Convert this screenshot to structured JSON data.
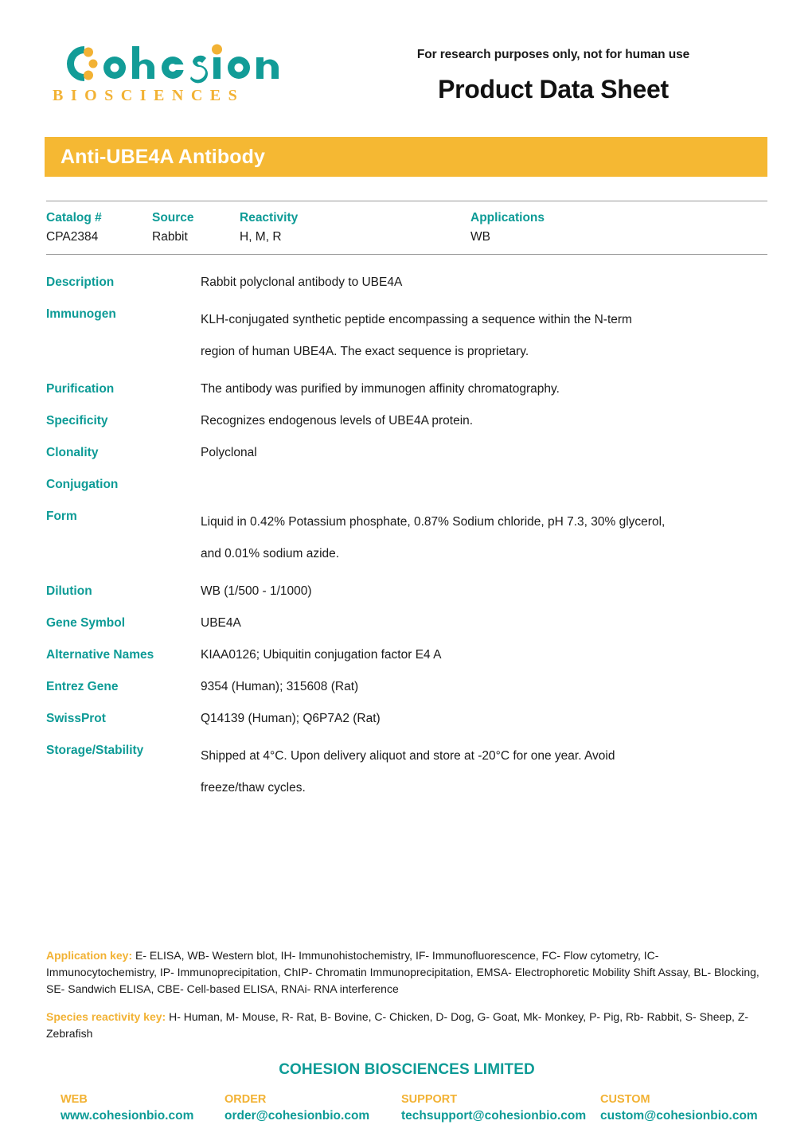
{
  "header": {
    "logo": {
      "brand": "Cohesion",
      "sub": "BIOSCIENCES",
      "teal": "#129C97",
      "orange": "#F2B234"
    },
    "research_note": "For research purposes only, not for human use",
    "page_title": "Product Data Sheet"
  },
  "banner": {
    "title": "Anti-UBE4A Antibody",
    "bg": "#F5B833",
    "fg": "#FFFFFF"
  },
  "spec_table": {
    "headers": [
      "Catalog #",
      "Source",
      "Reactivity",
      "Applications"
    ],
    "values": [
      "CPA2384",
      "Rabbit",
      "H, M, R",
      "WB"
    ]
  },
  "details": [
    {
      "label": "Description",
      "value": "Rabbit polyclonal antibody to UBE4A"
    },
    {
      "label": "Immunogen",
      "value": "KLH-conjugated synthetic peptide encompassing a sequence within the N-term\nregion of human UBE4A. The exact sequence is proprietary."
    },
    {
      "label": "Purification",
      "value": "The antibody was purified by immunogen affinity chromatography."
    },
    {
      "label": "Specificity",
      "value": "Recognizes endogenous levels of UBE4A protein."
    },
    {
      "label": "Clonality",
      "value": "Polyclonal"
    },
    {
      "label": "Conjugation",
      "value": ""
    },
    {
      "label": "Form",
      "value": "Liquid in 0.42% Potassium phosphate, 0.87% Sodium chloride, pH 7.3, 30% glycerol,\nand 0.01% sodium azide."
    },
    {
      "label": "Dilution",
      "value": "WB (1/500 - 1/1000)"
    },
    {
      "label": "Gene Symbol",
      "value": "UBE4A"
    },
    {
      "label": "Alternative Names",
      "value": "KIAA0126; Ubiquitin conjugation factor E4 A"
    },
    {
      "label": "Entrez Gene",
      "value": "9354 (Human); 315608 (Rat)"
    },
    {
      "label": "SwissProt",
      "value": "Q14139 (Human); Q6P7A2 (Rat)"
    },
    {
      "label": "Storage/Stability",
      "value": "Shipped at 4°C. Upon delivery aliquot and store at -20°C for one year. Avoid\nfreeze/thaw cycles."
    }
  ],
  "footer": {
    "application_key_label": "Application key:",
    "application_key_text": " E- ELISA, WB- Western blot, IH- Immunohistochemistry, IF- Immunofluorescence, FC- Flow cytometry, IC- Immunocytochemistry, IP- Immunoprecipitation, ChIP- Chromatin Immunoprecipitation, EMSA- Electrophoretic Mobility Shift Assay, BL- Blocking, SE- Sandwich ELISA, CBE- Cell-based ELISA, RNAi- RNA interference",
    "species_key_label": "Species reactivity key:",
    "species_key_text": " H- Human, M- Mouse, R- Rat, B- Bovine, C- Chicken, D- Dog, G- Goat, Mk- Monkey, P- Pig, Rb- Rabbit, S- Sheep, Z- Zebrafish",
    "company": "COHESION BIOSCIENCES LIMITED",
    "contacts": [
      {
        "label": "WEB",
        "value": "www.cohesionbio.com"
      },
      {
        "label": "ORDER",
        "value": "order@cohesionbio.com"
      },
      {
        "label": "SUPPORT",
        "value": "techsupport@cohesionbio.com"
      },
      {
        "label": "CUSTOM",
        "value": "custom@cohesionbio.com"
      }
    ]
  }
}
